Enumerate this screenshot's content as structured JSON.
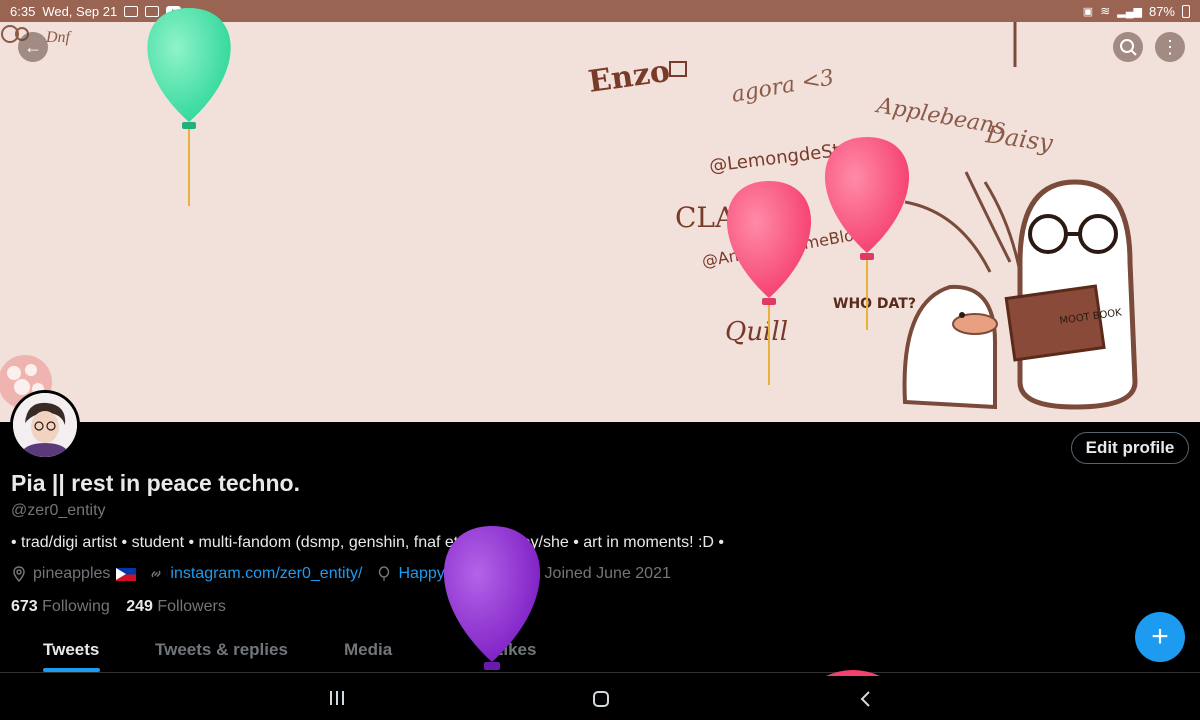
{
  "status_bar": {
    "time": "6:35",
    "date": "Wed, Sep 21",
    "battery": "87%"
  },
  "banner": {
    "doodle_names": [
      "Enzo",
      "agora <3",
      "Applebeans",
      "Daisy",
      "@LemongdeStand",
      "CLAUDE",
      "@AndreiDaLimeBlob",
      "Quill",
      "WHO DAT?",
      "MOOT BOOK"
    ]
  },
  "profile": {
    "edit_label": "Edit profile",
    "name": "Pia || rest in peace techno.",
    "handle": "@zer0_entity",
    "bio": "• trad/digi artist • student • multi-fandom (dsmp, genshin, fnaf etc) • he/they/she • art in moments! :D •",
    "location": "pineapples",
    "link": "instagram.com/zer0_entity/",
    "birthday": "Happy birthday!",
    "joined": "Joined June 2021",
    "following_count": "673",
    "following_label": "Following",
    "followers_count": "249",
    "followers_label": "Followers"
  },
  "tabs": [
    {
      "label": "Tweets",
      "active": true
    },
    {
      "label": "Tweets & replies",
      "active": false
    },
    {
      "label": "Media",
      "active": false
    },
    {
      "label": "Likes",
      "active": false
    }
  ],
  "colors": {
    "accent": "#1d9bf0",
    "status_bar": "#9a6452",
    "banner_bg": "#f1e1da"
  },
  "icons": [
    "back-arrow-icon",
    "search-icon",
    "more-vertical-icon",
    "location-icon",
    "link-icon",
    "balloon-icon",
    "calendar-icon",
    "plus-icon",
    "recents-icon",
    "home-icon",
    "back-icon"
  ]
}
